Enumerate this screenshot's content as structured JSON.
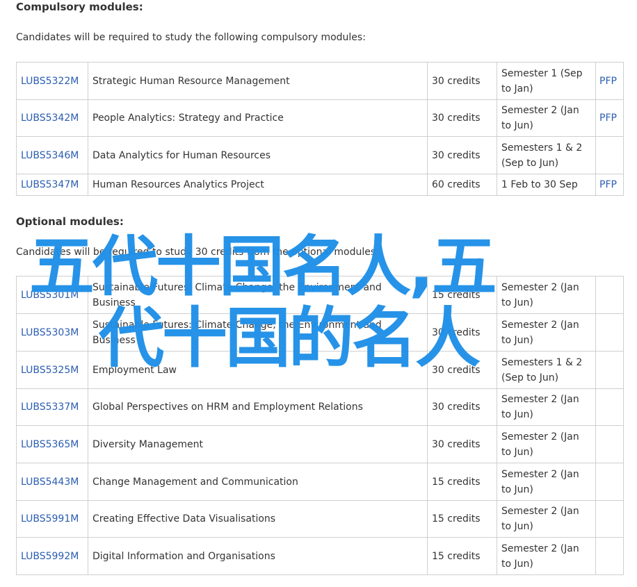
{
  "compulsory": {
    "heading": "Compulsory modules:",
    "intro": "Candidates will be required to study the following compulsory modules:",
    "rows": [
      {
        "code": "LUBS5322M",
        "title": "Strategic Human Resource Management",
        "credits": "30 credits",
        "semester": "Semester 1 (Sep to Jan)",
        "pfp": "PFP"
      },
      {
        "code": "LUBS5342M",
        "title": "People Analytics: Strategy and Practice",
        "credits": "30 credits",
        "semester": "Semester 2 (Jan to Jun)",
        "pfp": "PFP"
      },
      {
        "code": "LUBS5346M",
        "title": "Data Analytics for Human Resources",
        "credits": "30 credits",
        "semester": "Semesters 1 & 2 (Sep to Jun)",
        "pfp": ""
      },
      {
        "code": "LUBS5347M",
        "title": "Human Resources Analytics Project",
        "credits": "60 credits",
        "semester": "1 Feb to 30 Sep",
        "pfp": "PFP"
      }
    ]
  },
  "optional": {
    "heading": "Optional modules:",
    "intro": "Candidates will be required to study 30 credits from the optional modules",
    "rows": [
      {
        "code": "LUBS5301M",
        "title": "Sustainable Futures: Climate Change, the Environment and Business",
        "credits": "15 credits",
        "semester": "Semester 2 (Jan to Jun)",
        "pfp": ""
      },
      {
        "code": "LUBS5303M",
        "title": "Sustainable Futures: Climate Change, the Environment and Business",
        "credits": "30 credits",
        "semester": "Semester 2 (Jan to Jun)",
        "pfp": ""
      },
      {
        "code": "LUBS5325M",
        "title": "Employment Law",
        "credits": "30 credits",
        "semester": "Semesters 1 & 2 (Sep to Jun)",
        "pfp": ""
      },
      {
        "code": "LUBS5337M",
        "title": "Global Perspectives on HRM and Employment Relations",
        "credits": "30 credits",
        "semester": "Semester 2 (Jan to Jun)",
        "pfp": ""
      },
      {
        "code": "LUBS5365M",
        "title": "Diversity Management",
        "credits": "30 credits",
        "semester": "Semester 2 (Jan to Jun)",
        "pfp": ""
      },
      {
        "code": "LUBS5443M",
        "title": "Change Management and Communication",
        "credits": "15 credits",
        "semester": "Semester 2 (Jan to Jun)",
        "pfp": ""
      },
      {
        "code": "LUBS5991M",
        "title": "Creating Effective Data Visualisations",
        "credits": "15 credits",
        "semester": "Semester 2 (Jan to Jun)",
        "pfp": ""
      },
      {
        "code": "LUBS5992M",
        "title": "Digital Information and Organisations",
        "credits": "15 credits",
        "semester": "Semester 2 (Jan to Jun)",
        "pfp": ""
      }
    ]
  },
  "watermark": {
    "line1": "五代十国名人,五",
    "line2": "代十国的名人",
    "color": "#1e8fe8"
  },
  "colors": {
    "link": "#2a5db0",
    "text": "#333333",
    "border": "#cfcfcf"
  }
}
